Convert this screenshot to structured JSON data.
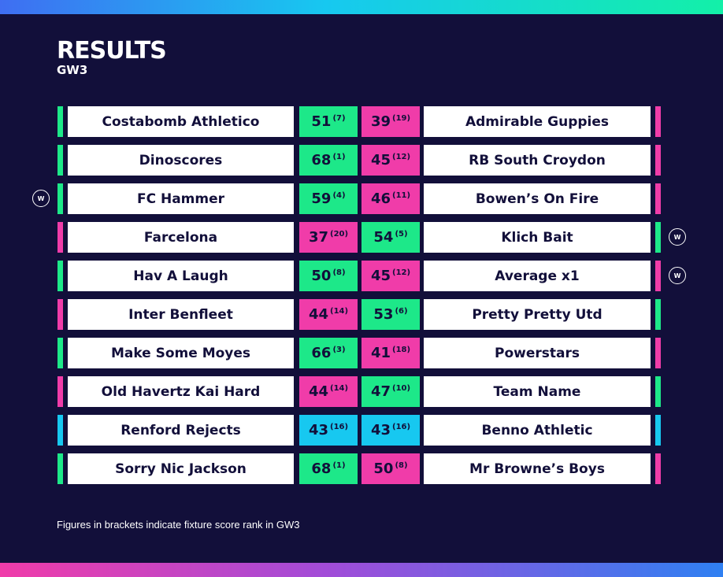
{
  "header": {
    "title": "RESULTS",
    "subtitle": "GW3"
  },
  "footnote": "Figures in brackets indicate fixture score rank in GW3",
  "colors": {
    "background": "#120f3a",
    "win": "#1de889",
    "loss": "#f03ca9",
    "draw": "#17c8f0",
    "text_dark": "#120f3a"
  },
  "win_badge_label": "W",
  "fixtures": [
    {
      "home_team": "Costabomb Athletico",
      "home_score": "51",
      "home_rank": "(7)",
      "away_score": "39",
      "away_rank": "(19)",
      "away_team": "Admirable Guppies",
      "home_color": "#1de889",
      "away_color": "#f03ca9",
      "home_badge": false,
      "away_badge": false
    },
    {
      "home_team": "Dinoscores",
      "home_score": "68",
      "home_rank": "(1)",
      "away_score": "45",
      "away_rank": "(12)",
      "away_team": "RB South Croydon",
      "home_color": "#1de889",
      "away_color": "#f03ca9",
      "home_badge": false,
      "away_badge": false
    },
    {
      "home_team": "FC Hammer",
      "home_score": "59",
      "home_rank": "(4)",
      "away_score": "46",
      "away_rank": "(11)",
      "away_team": "Bowen’s On Fire",
      "home_color": "#1de889",
      "away_color": "#f03ca9",
      "home_badge": true,
      "away_badge": false
    },
    {
      "home_team": "Farcelona",
      "home_score": "37",
      "home_rank": "(20)",
      "away_score": "54",
      "away_rank": "(5)",
      "away_team": "Klich Bait",
      "home_color": "#f03ca9",
      "away_color": "#1de889",
      "home_badge": false,
      "away_badge": true
    },
    {
      "home_team": "Hav A Laugh",
      "home_score": "50",
      "home_rank": "(8)",
      "away_score": "45",
      "away_rank": "(12)",
      "away_team": "Average x1",
      "home_color": "#1de889",
      "away_color": "#f03ca9",
      "home_badge": false,
      "away_badge": true
    },
    {
      "home_team": "Inter Benfleet",
      "home_score": "44",
      "home_rank": "(14)",
      "away_score": "53",
      "away_rank": "(6)",
      "away_team": "Pretty Pretty Utd",
      "home_color": "#f03ca9",
      "away_color": "#1de889",
      "home_badge": false,
      "away_badge": false
    },
    {
      "home_team": "Make Some Moyes",
      "home_score": "66",
      "home_rank": "(3)",
      "away_score": "41",
      "away_rank": "(18)",
      "away_team": "Powerstars",
      "home_color": "#1de889",
      "away_color": "#f03ca9",
      "home_badge": false,
      "away_badge": false
    },
    {
      "home_team": "Old Havertz Kai Hard",
      "home_score": "44",
      "home_rank": "(14)",
      "away_score": "47",
      "away_rank": "(10)",
      "away_team": "Team Name",
      "home_color": "#f03ca9",
      "away_color": "#1de889",
      "home_badge": false,
      "away_badge": false
    },
    {
      "home_team": "Renford Rejects",
      "home_score": "43",
      "home_rank": "(16)",
      "away_score": "43",
      "away_rank": "(16)",
      "away_team": "Benno Athletic",
      "home_color": "#17c8f0",
      "away_color": "#17c8f0",
      "home_badge": false,
      "away_badge": false
    },
    {
      "home_team": "Sorry Nic Jackson",
      "home_score": "68",
      "home_rank": "(1)",
      "away_score": "50",
      "away_rank": "(8)",
      "away_team": "Mr Browne’s Boys",
      "home_color": "#1de889",
      "away_color": "#f03ca9",
      "home_badge": false,
      "away_badge": false
    }
  ]
}
